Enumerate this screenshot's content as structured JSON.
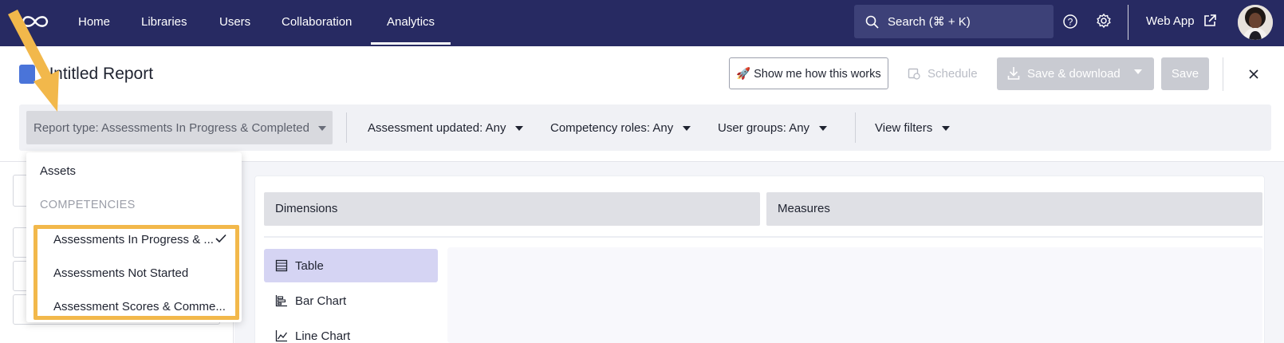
{
  "nav": {
    "items": [
      "Home",
      "Libraries",
      "Users",
      "Collaboration",
      "Analytics"
    ],
    "active": "Analytics",
    "search_placeholder": "Search (⌘ + K)",
    "web_app_label": "Web App"
  },
  "header": {
    "title": "Untitled Report",
    "show_me_label": "🚀 Show me how this works",
    "schedule_label": "Schedule",
    "save_download_label": "Save & download",
    "save_label": "Save"
  },
  "filters": {
    "report_type": "Report type: Assessments In Progress & Completed",
    "assessment_updated": "Assessment updated: Any",
    "competency_roles": "Competency roles: Any",
    "user_groups": "User groups: Any",
    "view_filters": "View filters"
  },
  "dropdown": {
    "item_assets": "Assets",
    "group_competencies": "COMPETENCIES",
    "options": [
      "Assessments In Progress & ...",
      "Assessments Not Started",
      "Assessment Scores & Comme..."
    ],
    "selected_index": 0
  },
  "builder": {
    "dimensions_label": "Dimensions",
    "measures_label": "Measures",
    "viz_types": [
      "Table",
      "Bar Chart",
      "Line Chart"
    ],
    "active_viz": "Table"
  },
  "colors": {
    "nav_bg": "#272a62",
    "highlight": "#f2b84b",
    "active_viz_bg": "#d5d4f3"
  }
}
